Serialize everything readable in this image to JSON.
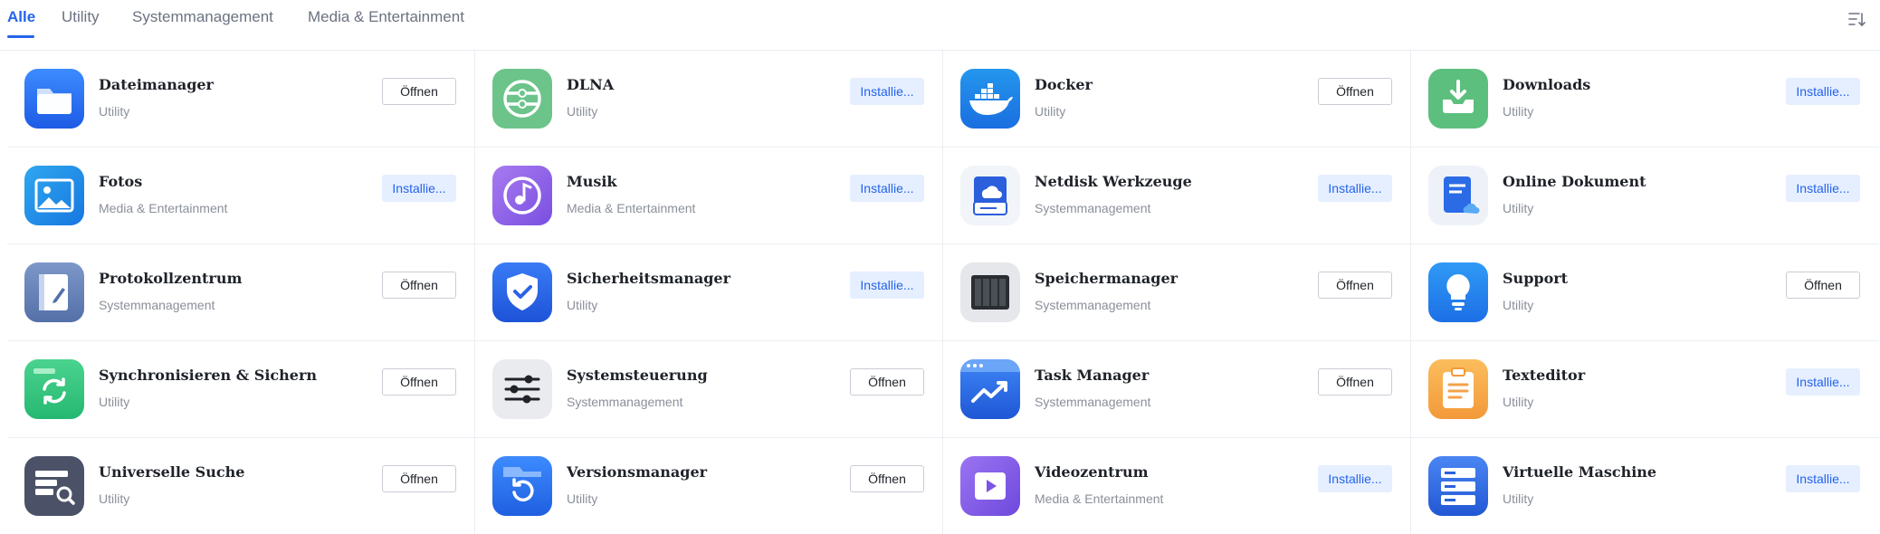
{
  "tabs": [
    {
      "label": "Alle",
      "active": true
    },
    {
      "label": "Utility",
      "active": false
    },
    {
      "label": "Systemmanagement",
      "active": false
    },
    {
      "label": "Media & Entertainment",
      "active": false
    }
  ],
  "sort_icon": "sort-list-icon",
  "colors": {
    "accent": "#2463eb",
    "install_bg": "#e6efff",
    "border": "#ebeef2"
  },
  "apps": [
    {
      "name": "Dateimanager",
      "category": "Utility",
      "button": "Öffnen",
      "button_type": "open",
      "icon": "folder-icon"
    },
    {
      "name": "DLNA",
      "category": "Utility",
      "button": "Installie...",
      "button_type": "install",
      "icon": "dlna-icon"
    },
    {
      "name": "Docker",
      "category": "Utility",
      "button": "Öffnen",
      "button_type": "open",
      "icon": "docker-whale-icon"
    },
    {
      "name": "Downloads",
      "category": "Utility",
      "button": "Installie...",
      "button_type": "install",
      "icon": "download-tray-icon"
    },
    {
      "name": "Fotos",
      "category": "Media & Entertainment",
      "button": "Installie...",
      "button_type": "install",
      "icon": "photo-icon"
    },
    {
      "name": "Musik",
      "category": "Media & Entertainment",
      "button": "Installie...",
      "button_type": "install",
      "icon": "music-note-icon"
    },
    {
      "name": "Netdisk Werkzeuge",
      "category": "Systemmanagement",
      "button": "Installie...",
      "button_type": "install",
      "icon": "cloud-drive-icon"
    },
    {
      "name": "Online Dokument",
      "category": "Utility",
      "button": "Installie...",
      "button_type": "install",
      "icon": "cloud-document-icon"
    },
    {
      "name": "Protokollzentrum",
      "category": "Systemmanagement",
      "button": "Öffnen",
      "button_type": "open",
      "icon": "log-book-icon"
    },
    {
      "name": "Sicherheitsmanager",
      "category": "Utility",
      "button": "Installie...",
      "button_type": "install",
      "icon": "shield-check-icon"
    },
    {
      "name": "Speichermanager",
      "category": "Systemmanagement",
      "button": "Öffnen",
      "button_type": "open",
      "icon": "storage-bays-icon"
    },
    {
      "name": "Support",
      "category": "Utility",
      "button": "Öffnen",
      "button_type": "open",
      "icon": "lightbulb-icon"
    },
    {
      "name": "Synchronisieren & Sichern",
      "category": "Utility",
      "button": "Öffnen",
      "button_type": "open",
      "icon": "sync-folder-icon"
    },
    {
      "name": "Systemsteuerung",
      "category": "Systemmanagement",
      "button": "Öffnen",
      "button_type": "open",
      "icon": "sliders-icon"
    },
    {
      "name": "Task Manager",
      "category": "Systemmanagement",
      "button": "Öffnen",
      "button_type": "open",
      "icon": "trend-chart-icon"
    },
    {
      "name": "Texteditor",
      "category": "Utility",
      "button": "Installie...",
      "button_type": "install",
      "icon": "clipboard-icon"
    },
    {
      "name": "Universelle Suche",
      "category": "Utility",
      "button": "Öffnen",
      "button_type": "open",
      "icon": "search-list-icon"
    },
    {
      "name": "Versionsmanager",
      "category": "Utility",
      "button": "Öffnen",
      "button_type": "open",
      "icon": "version-restore-icon"
    },
    {
      "name": "Videozentrum",
      "category": "Media & Entertainment",
      "button": "Installie...",
      "button_type": "install",
      "icon": "video-play-icon"
    },
    {
      "name": "Virtuelle Maschine",
      "category": "Utility",
      "button": "Installie...",
      "button_type": "install",
      "icon": "server-stack-icon"
    }
  ]
}
